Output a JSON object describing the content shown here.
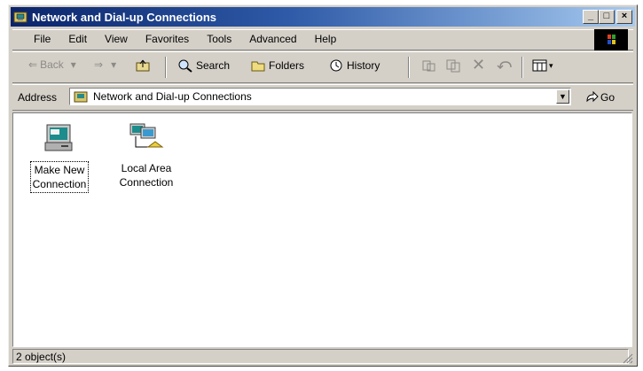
{
  "window": {
    "title": "Network and Dial-up Connections"
  },
  "menu": [
    "File",
    "Edit",
    "View",
    "Favorites",
    "Tools",
    "Advanced",
    "Help"
  ],
  "toolbar": {
    "back": "Back",
    "search": "Search",
    "folders": "Folders",
    "history": "History"
  },
  "address": {
    "label": "Address",
    "value": "Network and Dial-up Connections",
    "go": "Go"
  },
  "items": [
    {
      "line1": "Make New",
      "line2": "Connection"
    },
    {
      "line1": "Local Area",
      "line2": "Connection"
    }
  ],
  "status": {
    "text": "2 object(s)"
  },
  "colors": {
    "title_active_start": "#0a246a",
    "title_active_end": "#a6caf0",
    "face": "#d4d0c8"
  }
}
